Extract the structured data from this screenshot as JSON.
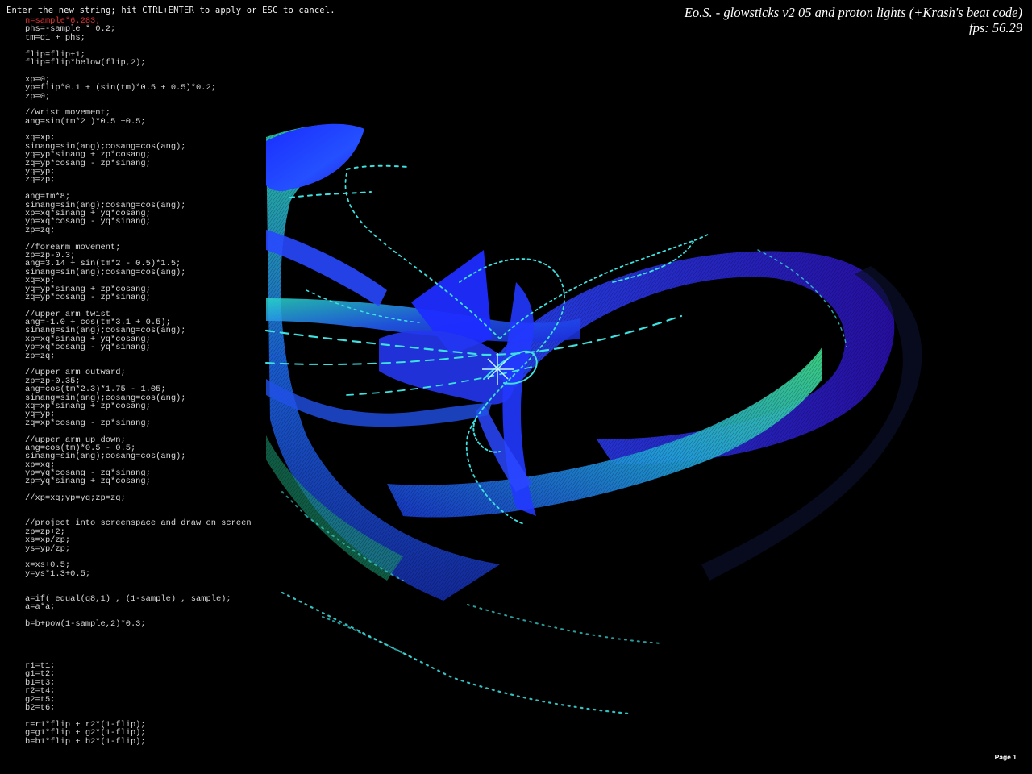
{
  "app": {
    "title": "Eo.S. - glowsticks v2 05 and proton lights (+Krash's beat code)",
    "fps": "fps: 56.29"
  },
  "editor": {
    "prompt": "Enter the new string; hit CTRL+ENTER to apply or ESC to cancel.",
    "code_lines": [
      "n=sample*6.283;",
      "phs=-sample * 0.2;",
      "tm=q1 + phs;",
      "",
      "flip=flip+1;",
      "flip=flip*below(flip,2);",
      "",
      "xp=0;",
      "yp=flip*0.1 + (sin(tm)*0.5 + 0.5)*0.2;",
      "zp=0;",
      "",
      "//wrist movement;",
      "ang=sin(tm*2 )*0.5 +0.5;",
      "",
      "xq=xp;",
      "sinang=sin(ang);cosang=cos(ang);",
      "yq=yp*sinang + zp*cosang;",
      "zq=yp*cosang - zp*sinang;",
      "yq=yp;",
      "zq=zp;",
      "",
      "ang=tm*8;",
      "sinang=sin(ang);cosang=cos(ang);",
      "xp=xq*sinang + yq*cosang;",
      "yp=xq*cosang - yq*sinang;",
      "zp=zq;",
      "",
      "//forearm movement;",
      "zp=zp-0.3;",
      "ang=3.14 + sin(tm*2 - 0.5)*1.5;",
      "sinang=sin(ang);cosang=cos(ang);",
      "xq=xp;",
      "yq=yp*sinang + zp*cosang;",
      "zq=yp*cosang - zp*sinang;",
      "",
      "//upper arm twist",
      "ang=-1.0 + cos(tm*3.1 + 0.5);",
      "sinang=sin(ang);cosang=cos(ang);",
      "xp=xq*sinang + yq*cosang;",
      "yp=xq*cosang - yq*sinang;",
      "zp=zq;",
      "",
      "//upper arm outward;",
      "zp=zp-0.35;",
      "ang=cos(tm*2.3)*1.75 - 1.05;",
      "sinang=sin(ang);cosang=cos(ang);",
      "xq=xp*sinang + zp*cosang;",
      "yq=yp;",
      "zq=xp*cosang - zp*sinang;",
      "",
      "//upper arm up down;",
      "ang=cos(tm)*0.5 - 0.5;",
      "sinang=sin(ang);cosang=cos(ang);",
      "xp=xq;",
      "yp=yq*cosang - zq*sinang;",
      "zp=yq*sinang + zq*cosang;",
      "",
      "//xp=xq;yp=yq;zp=zq;",
      "",
      "",
      "//project into screenspace and draw on screen",
      "zp=zp+2;",
      "xs=xp/zp;",
      "ys=yp/zp;",
      "",
      "x=xs+0.5;",
      "y=ys*1.3+0.5;",
      "",
      "",
      "a=if( equal(q8,1) , (1-sample) , sample);",
      "a=a*a;",
      "",
      "b=b+pow(1-sample,2)*0.3;",
      "",
      "",
      "",
      "",
      "r1=t1;",
      "g1=t2;",
      "b1=t3;",
      "r2=t4;",
      "g2=t5;",
      "b2=t6;",
      "",
      "r=r1*flip + r2*(1-flip);",
      "g=g1*flip + g2*(1-flip);",
      "b=b1*flip + b2*(1-flip);"
    ],
    "active_line_index": 0,
    "active_color": "#e03030",
    "text_color": "#d8d8d8"
  },
  "footer": {
    "page_label": "Page 1"
  },
  "colors": {
    "background": "#000000",
    "ribbon_blue": "#2a3cff",
    "ribbon_cyan": "#2ad4c8",
    "ribbon_green": "#40e08a",
    "dot_trail": "#3ee0e0"
  }
}
